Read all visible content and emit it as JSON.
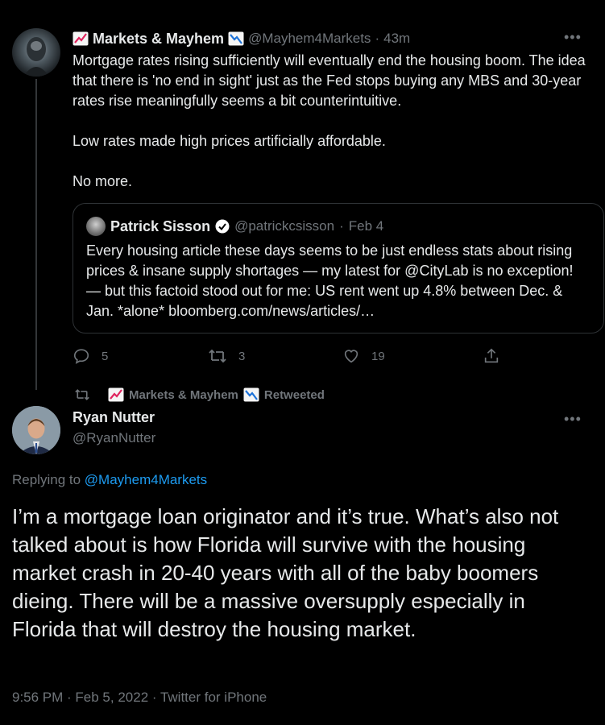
{
  "first_tweet": {
    "display_name": "Markets & Mayhem",
    "handle": "@Mayhem4Markets",
    "separator": "·",
    "time": "43m",
    "text": "Mortgage rates rising sufficiently will eventually end the housing boom. The idea that there is 'no end in sight' just as the Fed stops buying any MBS and 30-year rates rise meaningfully seems a bit counterintuitive.\n\nLow rates made high prices artificially affordable.\n\nNo more.",
    "more_icon": "more-dots-icon",
    "actions": {
      "reply_count": "5",
      "retweet_count": "3",
      "like_count": "19"
    }
  },
  "quoted_tweet": {
    "display_name": "Patrick Sisson",
    "handle": "@patrickcsisson",
    "separator": "·",
    "date": "Feb 4",
    "text": "Every housing article these days seems to be just endless stats about rising prices & insane supply shortages — my latest for @CityLab is no exception! — but this factoid stood out for me: US rent went up 4.8% between Dec. & Jan. *alone*  bloomberg.com/news/articles/…"
  },
  "retweet_banner": {
    "name": "Markets & Mayhem",
    "suffix": "Retweeted"
  },
  "main_tweet": {
    "display_name": "Ryan Nutter",
    "handle": "@RyanNutter",
    "replying_prefix": "Replying to",
    "replying_handle": "@Mayhem4Markets",
    "text": "I’m a mortgage loan originator and it’s true. What’s also not talked about is how Florida will survive with the housing market crash in 20-40 years with all of the baby boomers dieing. There will be a massive oversupply especially in Florida that will destroy the housing market.",
    "meta": "9:56 PM · Feb 5, 2022 · Twitter for iPhone"
  },
  "colors": {
    "background": "#000000",
    "text": "#e7e9ea",
    "muted": "#71767b",
    "link": "#1d9bf0",
    "verified": "#ffffff"
  }
}
